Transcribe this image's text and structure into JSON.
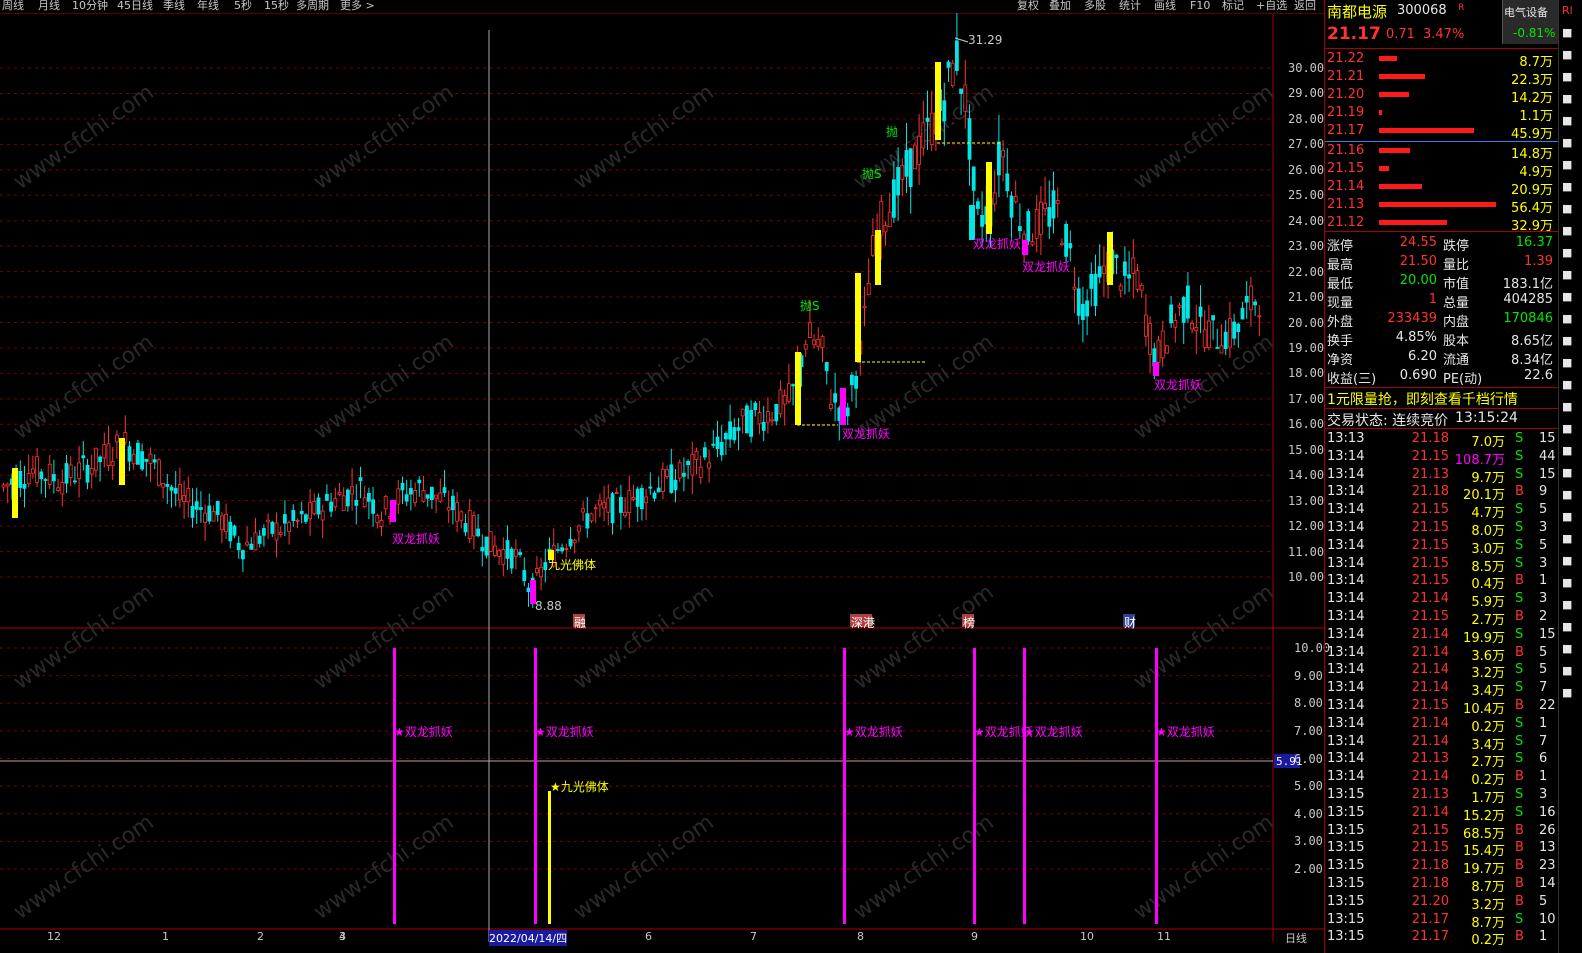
{
  "toolbar": {
    "periods": [
      "周线",
      "月线",
      "10分钟",
      "45日线",
      "季线",
      "年线",
      "5秒",
      "15秒",
      "多周期",
      "更多 >"
    ],
    "right_buttons": [
      "复权",
      "叠加",
      "多股",
      "统计",
      "画线",
      "F10",
      "标记",
      "+自选",
      "返回"
    ]
  },
  "chart": {
    "price_ticks": [
      "30.00",
      "29.00",
      "28.00",
      "27.00",
      "26.00",
      "25.00",
      "24.00",
      "23.00",
      "22.00",
      "21.00",
      "20.00",
      "19.00",
      "18.00",
      "17.00",
      "16.00",
      "15.00",
      "14.00",
      "13.00",
      "12.00",
      "11.00",
      "10.00"
    ],
    "indicator_ticks": [
      "10.00",
      "9.00",
      "8.00",
      "7.00",
      "6.00",
      "5.00",
      "4.00",
      "3.00",
      "2.00"
    ],
    "indicator_current": "5.91",
    "x_labels": [
      "12",
      "1",
      "2",
      "3",
      "4",
      "5",
      "6",
      "7",
      "8",
      "9",
      "10",
      "11"
    ],
    "cursor_date": "2022/04/14/四",
    "period_label": "日线",
    "high_label": "31.29",
    "low_label": "8.88",
    "signals": {
      "shuanglong": "双龙抓妖",
      "jiuguang": "九光佛体",
      "pao": "抛",
      "paos": "抛S",
      "star_shuanglong": "★双龙抓妖",
      "star_jiuguang": "★九光佛体"
    },
    "event_tags": [
      "融",
      "深港",
      "榜",
      "财"
    ],
    "watermark": "www.cfchi.com",
    "chart_data": {
      "type": "candlestick",
      "ylim": [
        9,
        31.29
      ],
      "high": 31.29,
      "low": 8.88
    }
  },
  "panel": {
    "name": "南都电源",
    "code": "300068",
    "tag": "R",
    "industry": "电气设备",
    "industry_change": "-0.81%",
    "price": "21.17",
    "change": "0.71",
    "change_pct": "3.47%",
    "asks": [
      {
        "p": "21.22",
        "v": "8.7万",
        "bar": 0.12
      },
      {
        "p": "21.21",
        "v": "22.3万",
        "bar": 0.31
      },
      {
        "p": "21.20",
        "v": "14.2万",
        "bar": 0.2
      },
      {
        "p": "21.19",
        "v": "1.1万",
        "bar": 0.02
      },
      {
        "p": "21.17",
        "v": "45.9万",
        "bar": 0.64
      }
    ],
    "bids": [
      {
        "p": "21.16",
        "v": "14.8万",
        "bar": 0.21
      },
      {
        "p": "21.15",
        "v": "4.9万",
        "bar": 0.07
      },
      {
        "p": "21.14",
        "v": "20.9万",
        "bar": 0.29
      },
      {
        "p": "21.13",
        "v": "56.4万",
        "bar": 0.79
      },
      {
        "p": "21.12",
        "v": "32.9万",
        "bar": 0.46
      }
    ],
    "stats": [
      [
        "涨停",
        "24.55",
        "跌停",
        "16.37"
      ],
      [
        "最高",
        "21.50",
        "量比",
        "1.39"
      ],
      [
        "最低",
        "20.00",
        "市值",
        "183.1亿"
      ],
      [
        "现量",
        "1",
        "总量",
        "404285"
      ],
      [
        "外盘",
        "233439",
        "内盘",
        "170846"
      ],
      [
        "换手",
        "4.85%",
        "股本",
        "8.65亿"
      ],
      [
        "净资",
        "6.20",
        "流通",
        "8.34亿"
      ],
      [
        "收益(三)",
        "0.690",
        "PE(动)",
        "22.6"
      ]
    ],
    "promo": "1元限量抢，即刻查看千档行情",
    "status_label": "交易状态: 连续竞价",
    "status_time": "13:15:24",
    "ticks": [
      [
        "13:13",
        "21.18",
        "7.0万",
        "S",
        "15"
      ],
      [
        "13:14",
        "21.15",
        "108.7万",
        "S",
        "44"
      ],
      [
        "13:14",
        "21.13",
        "9.7万",
        "S",
        "15"
      ],
      [
        "13:14",
        "21.18",
        "20.1万",
        "B",
        "9"
      ],
      [
        "13:14",
        "21.15",
        "4.7万",
        "S",
        "5"
      ],
      [
        "13:14",
        "21.15",
        "8.0万",
        "S",
        "3"
      ],
      [
        "13:14",
        "21.15",
        "3.0万",
        "S",
        "5"
      ],
      [
        "13:14",
        "21.15",
        "8.5万",
        "S",
        "3"
      ],
      [
        "13:14",
        "21.15",
        "0.4万",
        "B",
        "1"
      ],
      [
        "13:14",
        "21.14",
        "5.9万",
        "S",
        "3"
      ],
      [
        "13:14",
        "21.15",
        "2.7万",
        "B",
        "2"
      ],
      [
        "13:14",
        "21.14",
        "19.9万",
        "S",
        "15"
      ],
      [
        "13:14",
        "21.14",
        "3.6万",
        "B",
        "5"
      ],
      [
        "13:14",
        "21.14",
        "3.2万",
        "S",
        "5"
      ],
      [
        "13:14",
        "21.14",
        "3.4万",
        "S",
        "7"
      ],
      [
        "13:14",
        "21.15",
        "10.4万",
        "B",
        "22"
      ],
      [
        "13:14",
        "21.14",
        "0.2万",
        "S",
        "1"
      ],
      [
        "13:14",
        "21.14",
        "3.4万",
        "S",
        "7"
      ],
      [
        "13:14",
        "21.13",
        "2.7万",
        "S",
        "6"
      ],
      [
        "13:14",
        "21.14",
        "0.2万",
        "B",
        "1"
      ],
      [
        "13:15",
        "21.13",
        "1.7万",
        "S",
        "3"
      ],
      [
        "13:15",
        "21.14",
        "15.2万",
        "S",
        "16"
      ],
      [
        "13:15",
        "21.15",
        "68.5万",
        "B",
        "26"
      ],
      [
        "13:15",
        "21.15",
        "15.4万",
        "B",
        "13"
      ],
      [
        "13:15",
        "21.18",
        "19.7万",
        "B",
        "23"
      ],
      [
        "13:15",
        "21.18",
        "8.7万",
        "B",
        "14"
      ],
      [
        "13:15",
        "21.20",
        "3.2万",
        "B",
        "5"
      ],
      [
        "13:15",
        "21.17",
        "8.7万",
        "S",
        "10"
      ],
      [
        "13:15",
        "21.17",
        "0.2万",
        "B",
        "1"
      ]
    ]
  },
  "farbar": [
    "Rl",
    "■",
    "■",
    "■",
    "■",
    "■",
    "■",
    "■",
    "■",
    "■",
    "■",
    "■",
    "■",
    "■",
    "■",
    "■",
    "■",
    "■",
    "■",
    "■",
    "■",
    "■",
    "■",
    "■",
    "■",
    "■",
    "■",
    "■",
    "■",
    "■",
    "■",
    "■"
  ]
}
